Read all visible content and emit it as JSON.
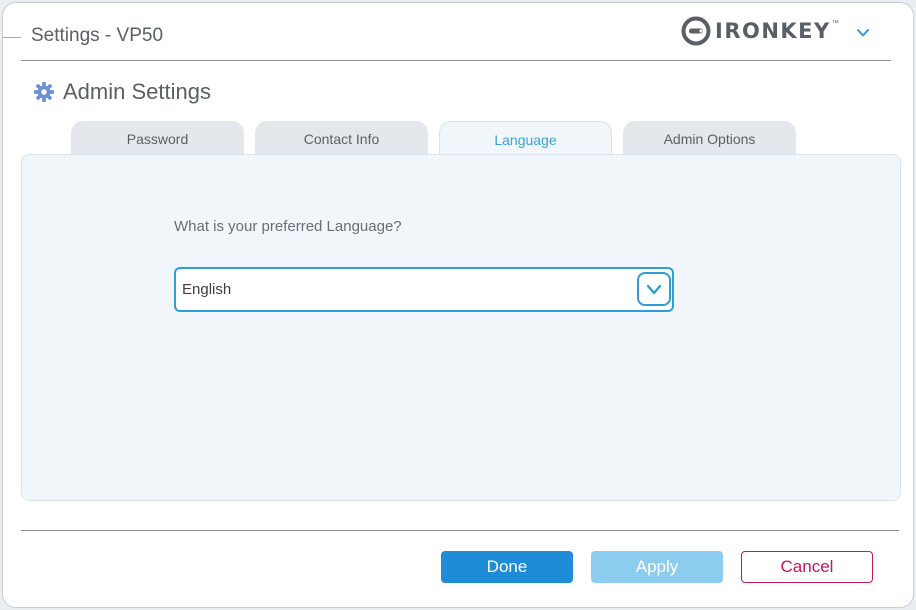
{
  "window": {
    "title": "Settings - VP50"
  },
  "brand": {
    "logo_text": "IRONKEY",
    "trademark": "™",
    "menu_icon": "chevron-down-icon"
  },
  "section": {
    "title": "Admin Settings",
    "icon": "gear-icon"
  },
  "tabs": [
    {
      "label": "Password",
      "active": false
    },
    {
      "label": "Contact Info",
      "active": false
    },
    {
      "label": "Language",
      "active": true
    },
    {
      "label": "Admin Options",
      "active": false
    }
  ],
  "language": {
    "question": "What is your preferred Language?",
    "selected": "English"
  },
  "buttons": {
    "done": "Done",
    "apply": "Apply",
    "cancel": "Cancel"
  },
  "colors": {
    "accent": "#2f9ed8",
    "done_bg": "#1e8cd6",
    "apply_bg": "#8ccdef",
    "cancel": "#c2185b",
    "panel_bg": "#f1f6fb"
  }
}
